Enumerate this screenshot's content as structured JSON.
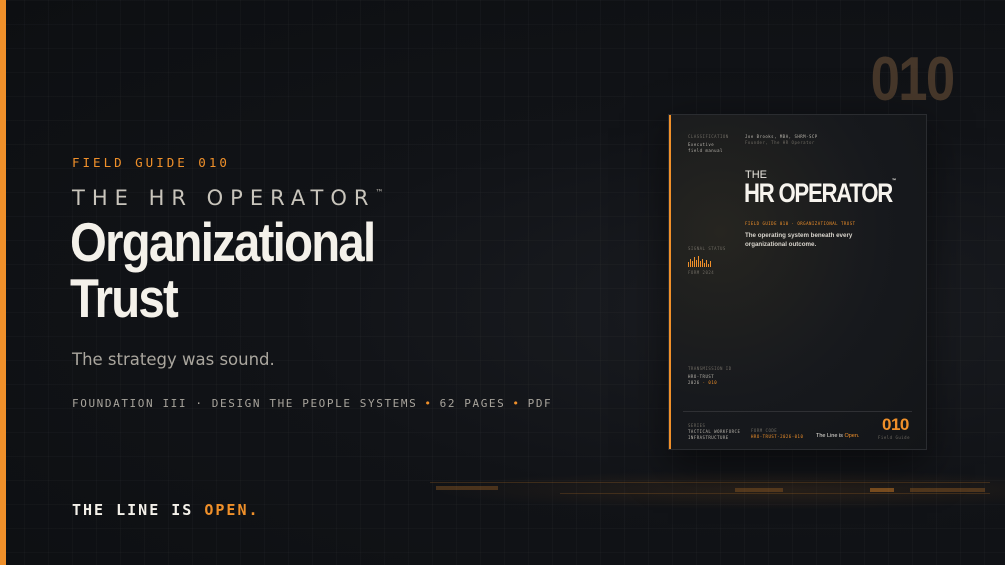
{
  "hero": {
    "kicker": "FIELD GUIDE 010",
    "series": "THE HR OPERATOR",
    "series_mark": "™",
    "title_line1": "Organizational",
    "title_line2": "Trust",
    "subtitle": "The strategy was sound.",
    "meta": {
      "part1": "FOUNDATION III · DESIGN THE PEOPLE SYSTEMS",
      "sep": "•",
      "part2": "62 PAGES",
      "part3": "PDF"
    },
    "tagline_prefix": "THE LINE IS ",
    "tagline_highlight": "OPEN."
  },
  "edition_number": "010",
  "cover": {
    "classification_label": "CLASSIFICATION",
    "classification_value_1": "Executive",
    "classification_value_2": "field manual",
    "author_line1": "Joe Brooks, MBA, SHRM-SCP",
    "author_line2": "Founder, The HR Operator",
    "the": "THE",
    "title": "HR OPERATOR",
    "title_mark": "™",
    "field_guide_line": "FIELD GUIDE 010 · ORGANIZATIONAL TRUST",
    "tagline": "The operating system beneath every organizational outcome.",
    "signal_label": "SIGNAL STATUS",
    "signal_value": "FORM 2024",
    "signal_bars": [
      0.45,
      0.7,
      0.55,
      0.9,
      0.6,
      1.0,
      0.5,
      0.75,
      0.4,
      0.65,
      0.3,
      0.5
    ],
    "transmission_label": "TRANSMISSION ID",
    "transmission_value_1": "HRO-TRUST",
    "transmission_year": "2026",
    "transmission_dot": "·",
    "transmission_code": "010",
    "series_label": "SERIES",
    "series_value_1": "TACTICAL WORKFORCE",
    "series_value_2": "INFRASTRUCTURE",
    "form_label": "FORM CODE",
    "form_code": "HRO-TRUST-2026-010",
    "line_prefix": "The Line is ",
    "line_highlight": "Open.",
    "number": "010",
    "number_caption": "Field Guide"
  },
  "colors": {
    "accent": "#f0902a",
    "background": "#111317",
    "text": "#f4f1ea"
  }
}
